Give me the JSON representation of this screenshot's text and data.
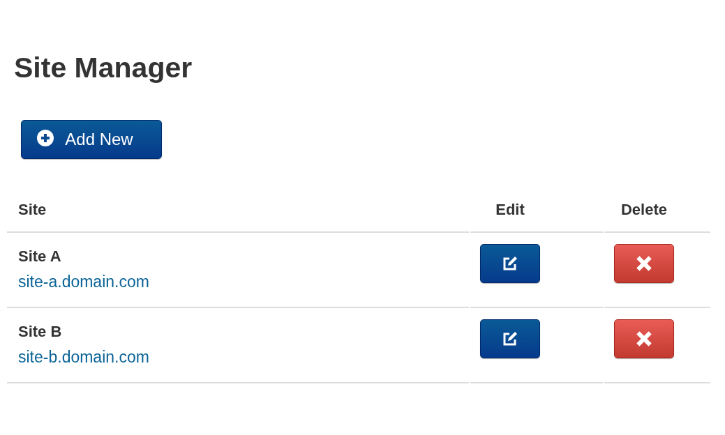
{
  "title": "Site Manager",
  "add_button": {
    "label": "Add New"
  },
  "table": {
    "columns": [
      "Site",
      "Edit",
      "Delete"
    ],
    "rows": [
      {
        "name": "Site A",
        "url": "site-a.domain.com"
      },
      {
        "name": "Site B",
        "url": "site-b.domain.com"
      }
    ]
  }
}
